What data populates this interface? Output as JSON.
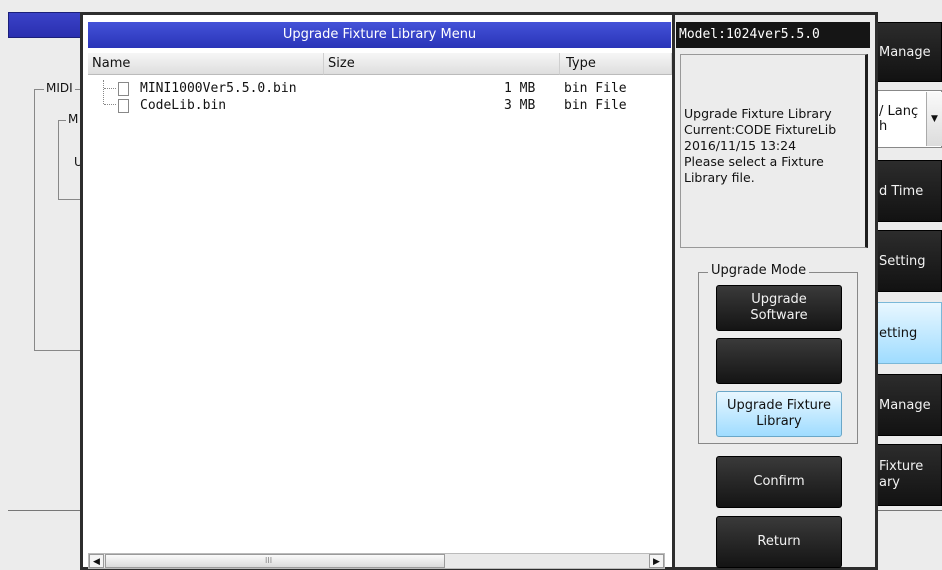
{
  "background": {
    "midi_label": "MIDI",
    "inner_label": "M",
    "inner_label2": "U"
  },
  "right_buttons": [
    {
      "label": "Manage"
    },
    {
      "label": "/ Lanç\nh"
    },
    {
      "label": "d Time"
    },
    {
      "label": "Setting"
    },
    {
      "label": "etting"
    },
    {
      "label": "Manage"
    },
    {
      "label": "Fixture\nary"
    }
  ],
  "dialog": {
    "title": "Upgrade Fixture Library Menu",
    "columns": {
      "name": "Name",
      "size": "Size",
      "type": "Type"
    },
    "files": [
      {
        "name": "MINI1000Ver5.5.0.bin",
        "size": "1 MB",
        "type": "bin File"
      },
      {
        "name": "CodeLib.bin",
        "size": "3 MB",
        "type": "bin File"
      }
    ],
    "scroll_center_mark": "III"
  },
  "info": {
    "model": "Model:1024ver5.5.0",
    "message": "Upgrade Fixture Library\nCurrent:CODE FixtureLib\n2016/11/15 13:24\nPlease select a Fixture\nLibrary file.",
    "mode_legend": "Upgrade Mode",
    "mode_buttons": [
      {
        "label": "Upgrade\nSoftware",
        "selected": false
      },
      {
        "label": "",
        "selected": false
      },
      {
        "label": "Upgrade Fixture\nLibrary",
        "selected": true
      }
    ],
    "confirm": "Confirm",
    "return": "Return"
  },
  "colors": {
    "title_bar": "#3440c4",
    "selected_button": "#aee2ff",
    "dark_button": "#1a1a1a"
  }
}
